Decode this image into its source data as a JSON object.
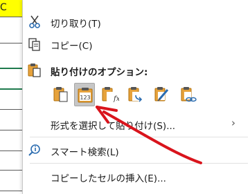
{
  "sheet": {
    "header_cell": "C"
  },
  "menu": {
    "cut": {
      "label": "切り取り(T)",
      "icon": "scissors-icon"
    },
    "copy": {
      "label": "コピー(C)",
      "icon": "copy-icon"
    },
    "paste_options": {
      "label": "貼り付けのオプション:",
      "icon": "clipboard-icon",
      "buttons": [
        {
          "name": "paste-button",
          "icon": "paste-icon"
        },
        {
          "name": "paste-values-button",
          "icon": "paste-values-123-icon",
          "selected": true
        },
        {
          "name": "paste-formulas-button",
          "icon": "paste-formulas-fx-icon"
        },
        {
          "name": "paste-transpose-button",
          "icon": "paste-transpose-icon"
        },
        {
          "name": "paste-formatting-button",
          "icon": "paste-formatting-brush-icon"
        },
        {
          "name": "paste-link-button",
          "icon": "paste-link-icon"
        }
      ]
    },
    "paste_special": {
      "label": "形式を選択して貼り付け(S)...",
      "chevron": "›"
    },
    "smart_lookup": {
      "label": "スマート検索(L)",
      "icon": "smart-lookup-icon"
    },
    "insert_copied": {
      "label": "コピーしたセルの挿入(E)..."
    }
  },
  "colors": {
    "highlight_yellow": "#ffff00",
    "annotation_red": "#d9141c",
    "clipboard_orange": "#c8820a",
    "icon_blue": "#2b6cb0"
  },
  "annotation": {
    "type": "hand-drawn arrow pointing to paste-values button"
  }
}
